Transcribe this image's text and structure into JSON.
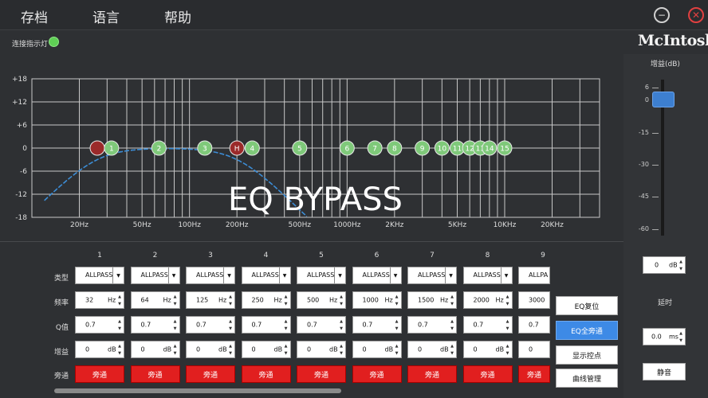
{
  "menu": {
    "items": [
      "存档",
      "语言",
      "帮助"
    ]
  },
  "window": {
    "minimize": "−",
    "close": "✕"
  },
  "status": {
    "label": "连接指示灯",
    "led_color": "#5fcf55"
  },
  "brand": {
    "logo": "McIntosh"
  },
  "graph": {
    "y_ticks": [
      "+18",
      "+12",
      "+6",
      "0",
      "-6",
      "-12",
      "-18"
    ],
    "y_values": [
      18,
      12,
      6,
      0,
      -6,
      -12,
      -18
    ],
    "x_labels": [
      {
        "text": "20Hz",
        "f": 20
      },
      {
        "text": "50Hz",
        "f": 50
      },
      {
        "text": "100Hz",
        "f": 100
      },
      {
        "text": "200Hz",
        "f": 200
      },
      {
        "text": "500Hz",
        "f": 500
      },
      {
        "text": "1000Hz",
        "f": 1000
      },
      {
        "text": "2KHz",
        "f": 2000
      },
      {
        "text": "5KHz",
        "f": 5000
      },
      {
        "text": "10KHz",
        "f": 10000
      },
      {
        "text": "20KHz",
        "f": 20000
      }
    ],
    "bypass_text": "EQ BYPASS",
    "nodes": [
      {
        "label": "",
        "f": 26,
        "type": "low-marker"
      },
      {
        "label": "1",
        "f": 32
      },
      {
        "label": "2",
        "f": 64
      },
      {
        "label": "3",
        "f": 125
      },
      {
        "label": "H",
        "f": 200,
        "type": "high-marker"
      },
      {
        "label": "4",
        "f": 250
      },
      {
        "label": "5",
        "f": 500
      },
      {
        "label": "6",
        "f": 1000
      },
      {
        "label": "7",
        "f": 1500
      },
      {
        "label": "8",
        "f": 2000
      },
      {
        "label": "9",
        "f": 3000
      },
      {
        "label": "10",
        "f": 4000
      },
      {
        "label": "11",
        "f": 5000
      },
      {
        "label": "12",
        "f": 6000
      },
      {
        "label": "13",
        "f": 7000
      },
      {
        "label": "14",
        "f": 8000
      },
      {
        "label": "15",
        "f": 10000
      }
    ],
    "colors": {
      "node_fill": "#7fc97a",
      "marker_fill": "#9b2a2a",
      "curve": "#3c8dd6",
      "grid": "#c8c8c8"
    }
  },
  "right_panel": {
    "gain_label": "增益(dB)",
    "ticks": [
      "6",
      "0",
      "-15",
      "-30",
      "-45",
      "-60"
    ],
    "gain_value": "0",
    "gain_unit": "dB",
    "delay_label": "延时",
    "delay_value": "0.0",
    "delay_unit": "ms",
    "mute_label": "静音"
  },
  "table": {
    "row_labels": {
      "type": "类型",
      "freq": "频率",
      "q": "Q值",
      "gain": "增益",
      "bypass": "旁通"
    },
    "channels": [
      {
        "num": "1",
        "type": "ALLPASS",
        "freq": "32",
        "q": "0.7",
        "gain": "0",
        "bypass": "旁通"
      },
      {
        "num": "2",
        "type": "ALLPASS",
        "freq": "64",
        "q": "0.7",
        "gain": "0",
        "bypass": "旁通"
      },
      {
        "num": "3",
        "type": "ALLPASS",
        "freq": "125",
        "q": "0.7",
        "gain": "0",
        "bypass": "旁通"
      },
      {
        "num": "4",
        "type": "ALLPASS",
        "freq": "250",
        "q": "0.7",
        "gain": "0",
        "bypass": "旁通"
      },
      {
        "num": "5",
        "type": "ALLPASS",
        "freq": "500",
        "q": "0.7",
        "gain": "0",
        "bypass": "旁通"
      },
      {
        "num": "6",
        "type": "ALLPASS",
        "freq": "1000",
        "q": "0.7",
        "gain": "0",
        "bypass": "旁通"
      },
      {
        "num": "7",
        "type": "ALLPASS",
        "freq": "1500",
        "q": "0.7",
        "gain": "0",
        "bypass": "旁通"
      },
      {
        "num": "8",
        "type": "ALLPASS",
        "freq": "2000",
        "q": "0.7",
        "gain": "0",
        "bypass": "旁通"
      },
      {
        "num": "9",
        "type": "ALLPA",
        "freq": "3000",
        "q": "0.7",
        "gain": "0",
        "bypass": "旁通"
      }
    ],
    "freq_unit": "Hz",
    "gain_unit": "dB"
  },
  "side_buttons": [
    {
      "label": "EQ复位",
      "active": false
    },
    {
      "label": "EQ全旁通",
      "active": true
    },
    {
      "label": "显示控点",
      "active": false
    },
    {
      "label": "曲线管理",
      "active": false
    }
  ]
}
